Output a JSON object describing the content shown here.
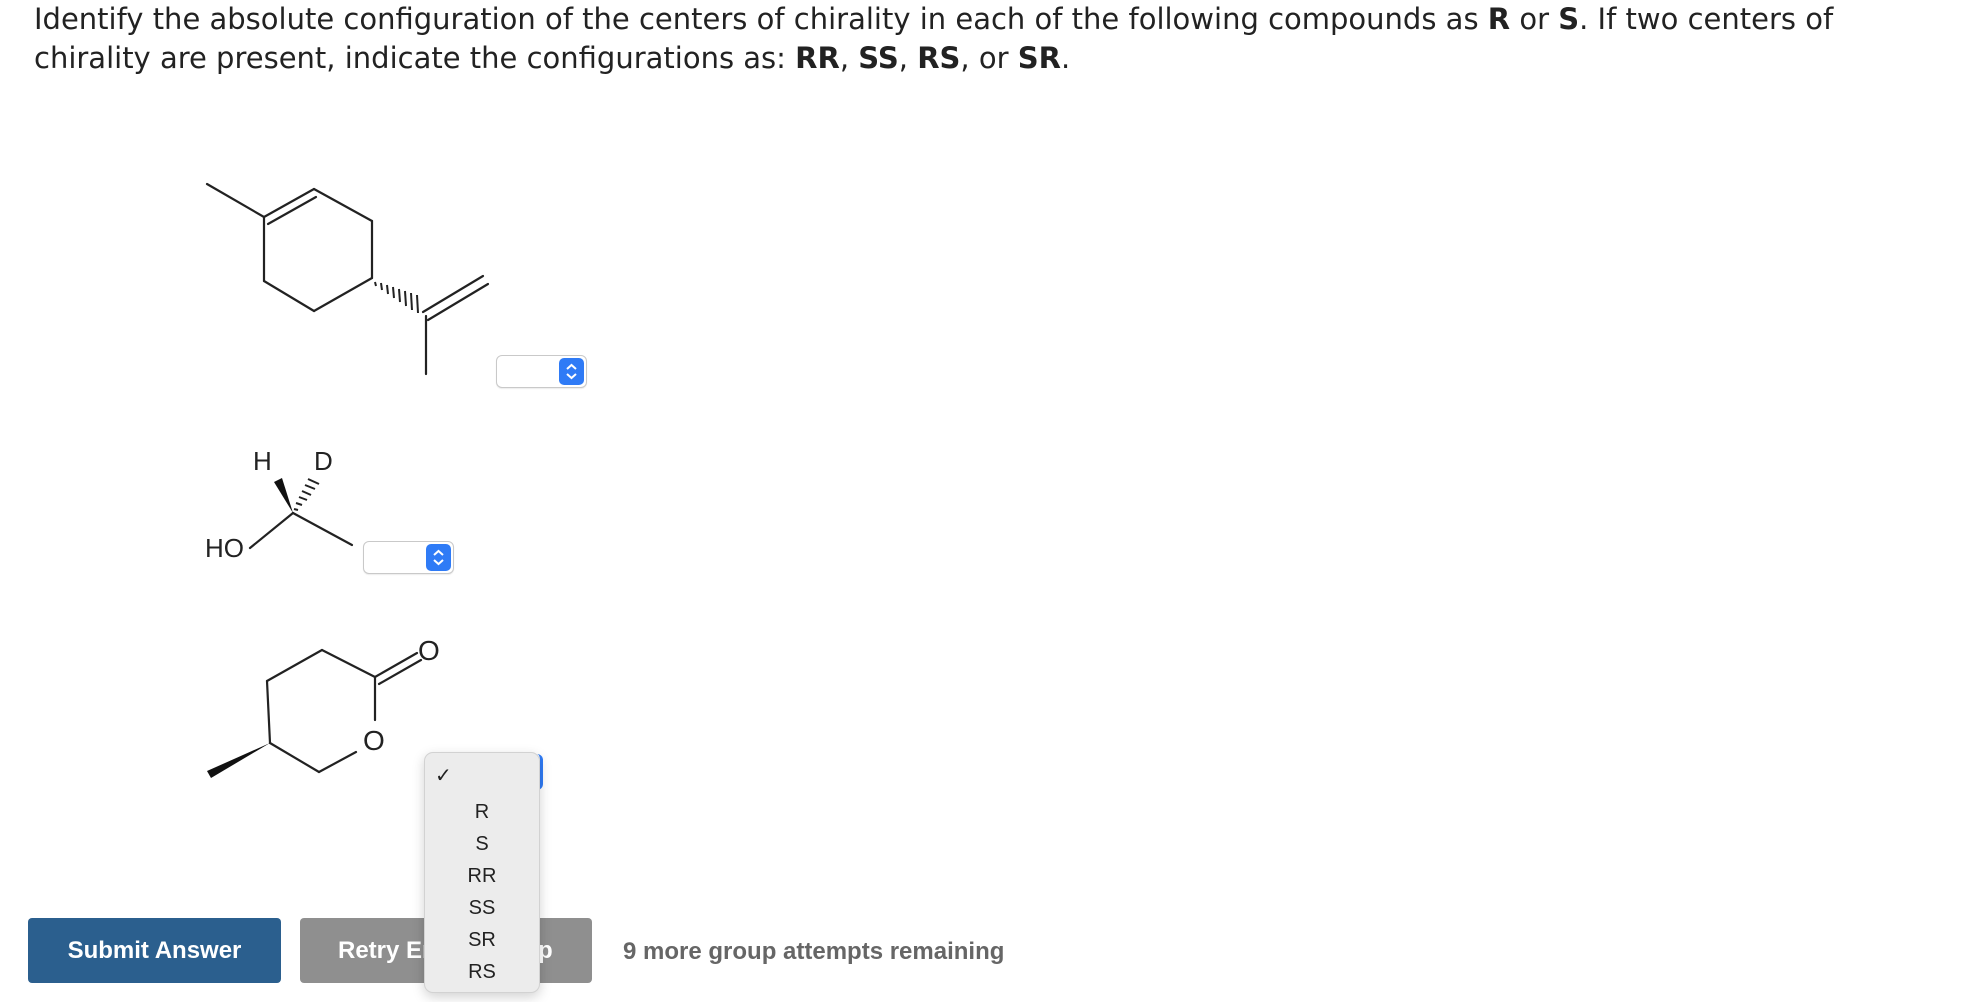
{
  "question": {
    "part1": "Identify the absolute configuration of the centers of chirality in each of the following compounds as ",
    "R": "R",
    "or1": " or ",
    "S": "S",
    "part2": ". If two centers of chirality are present, indicate the configurations as: ",
    "RR": "RR",
    "sep1": ", ",
    "SS": "SS",
    "sep2": ", ",
    "RS": "RS",
    "sep3": ", or ",
    "SR": "SR",
    "end": "."
  },
  "molecules": {
    "mol2_labels": {
      "H": "H",
      "D": "D",
      "HO": "HO"
    },
    "mol3_labels": {
      "carbonyl_O": "O",
      "ring_O": "O"
    }
  },
  "dropdown": {
    "checkmark": "✓",
    "options": [
      "R",
      "S",
      "RR",
      "SS",
      "SR",
      "RS"
    ]
  },
  "buttons": {
    "submit": "Submit Answer",
    "retry": "Retry Entire Group"
  },
  "status": {
    "attempts": "9 more group attempts remaining"
  },
  "colors": {
    "submit_bg": "#2b5f8e",
    "retry_bg": "#8f8f8f",
    "select_arrow": "#2f7bf6"
  }
}
